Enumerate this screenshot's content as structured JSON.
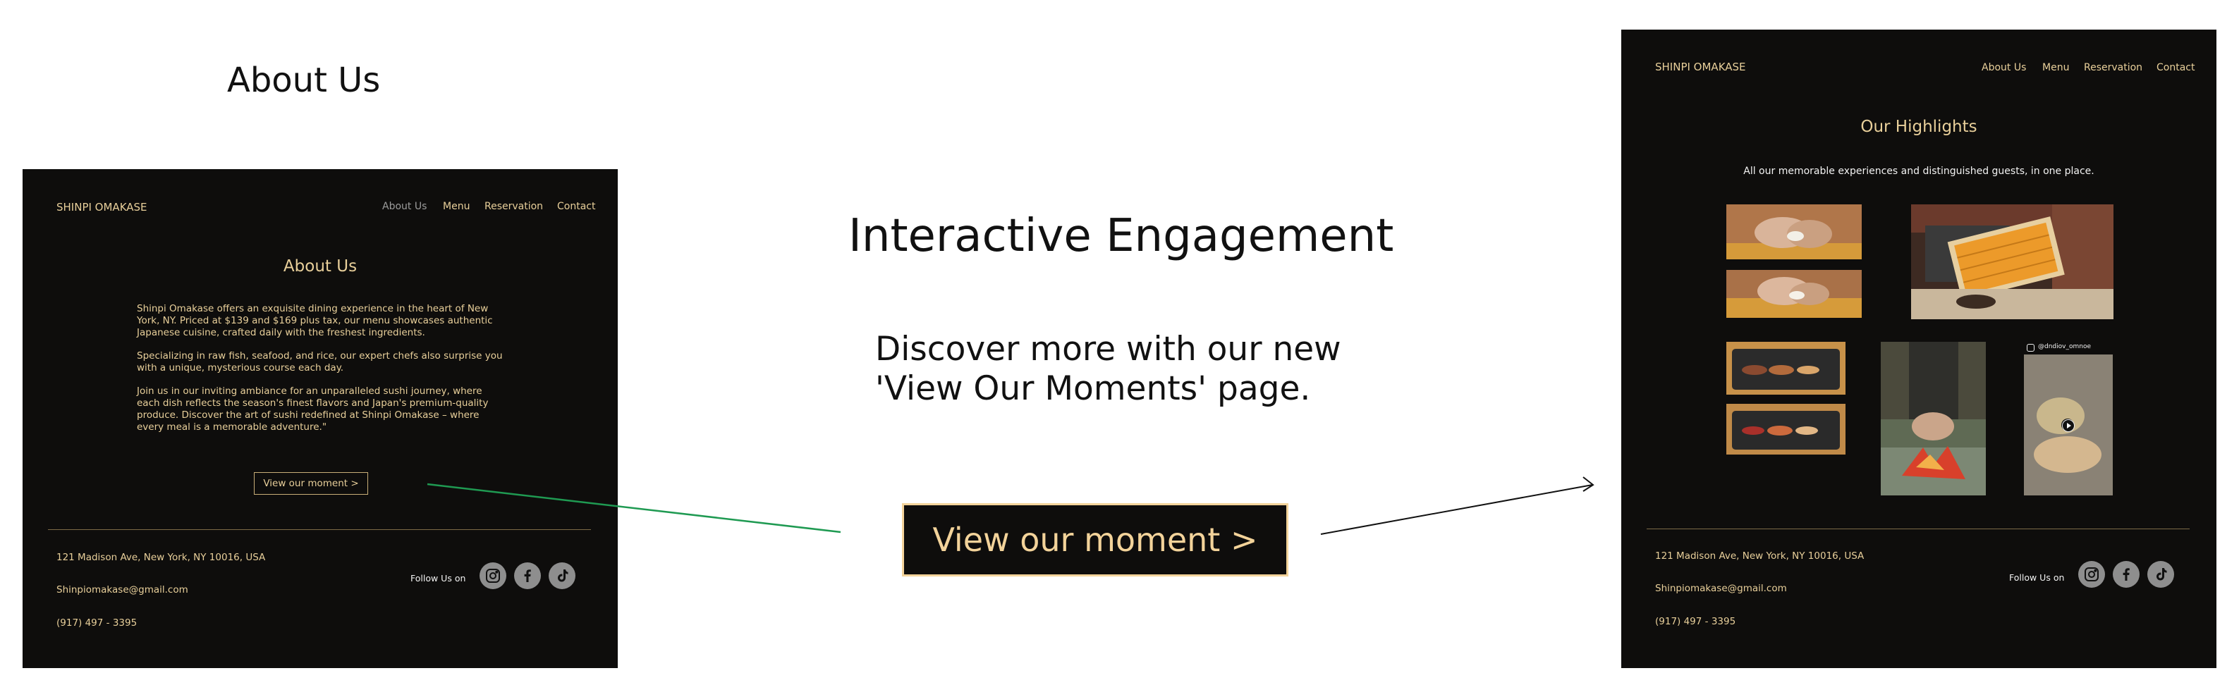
{
  "left": {
    "label": "About Us",
    "brand": "SHINPI OMAKASE",
    "nav": [
      "About Us",
      "Menu",
      "Reservation",
      "Contact"
    ],
    "title": "About Us",
    "paragraphs": [
      "Shinpi Omakase offers an exquisite dining experience in the heart of New York, NY. Priced at $139 and $169 plus tax, our menu showcases authentic Japanese cuisine, crafted daily with the freshest ingredients.",
      "Specializing in raw fish, seafood, and rice, our expert chefs also surprise you with a unique, mysterious course each day.",
      "Join us in our inviting ambiance for an unparalleled sushi journey, where each dish reflects the season's finest flavors and Japan's premium-quality produce. Discover the art of sushi redefined at Shinpi Omakase – where every meal is a memorable adventure.\""
    ],
    "cta": "View our moment >",
    "footer": {
      "address": "121 Madison Ave, New York, NY 10016, USA",
      "email": "Shinpiomakase@gmail.com",
      "phone": "(917) 497 - 3395",
      "follow": "Follow Us on"
    }
  },
  "center": {
    "title": "Interactive Engagement",
    "line1": "Discover more with our new",
    "line2": "'View Our Moments' page.",
    "cta": "View our moment >"
  },
  "right": {
    "brand": "SHINPI OMAKASE",
    "nav": [
      "About Us",
      "Menu",
      "Reservation",
      "Contact"
    ],
    "title": "Our Highlights",
    "subtitle": "All our memorable experiences and distinguished guests, in one place.",
    "ig_handle": "@dndiov_omnoe",
    "footer": {
      "address": "121 Madison Ave, New York, NY 10016, USA",
      "email": "Shinpiomakase@gmail.com",
      "phone": "(917) 497 - 3395",
      "follow": "Follow Us on"
    }
  },
  "colors": {
    "panel": "#0e0d0c",
    "gold": "#e8cf9a",
    "green_arrow": "#1f9a52",
    "social": "#8e8e8e"
  },
  "icons": [
    "instagram-icon",
    "facebook-icon",
    "tiktok-icon",
    "play-icon"
  ]
}
